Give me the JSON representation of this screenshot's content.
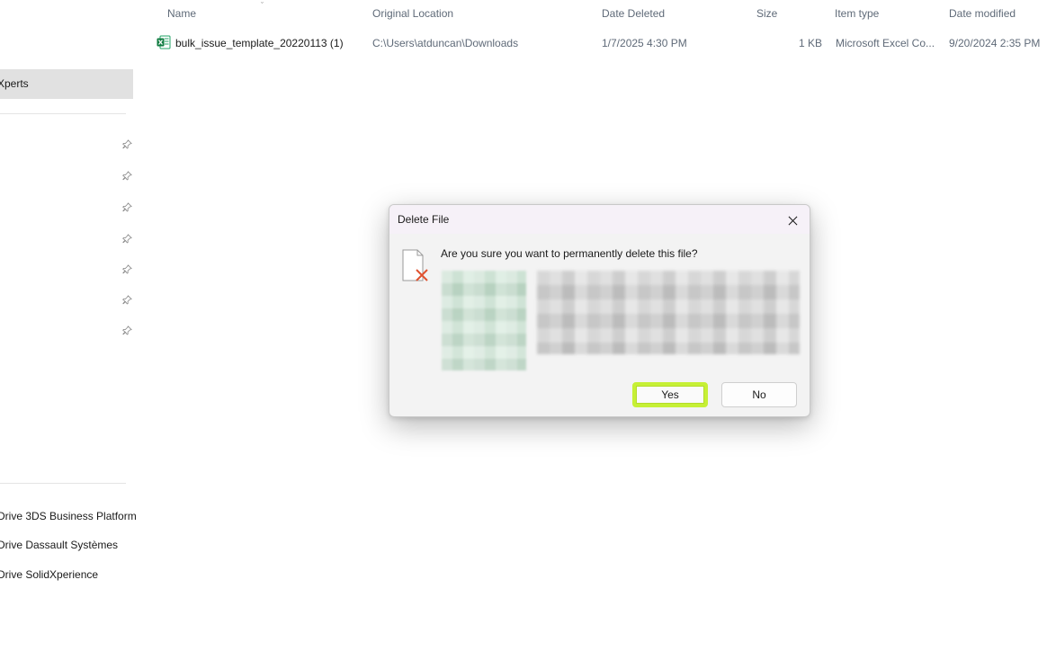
{
  "sidebar": {
    "selected_item": "Xperts",
    "pinned_count": 7,
    "links": [
      "Drive 3DS Business Platform",
      "Drive Dassault Systèmes",
      "Drive SolidXperience"
    ]
  },
  "file_list": {
    "columns": [
      "Name",
      "Original Location",
      "Date Deleted",
      "Size",
      "Item type",
      "Date modified"
    ],
    "rows": [
      {
        "name": "bulk_issue_template_20220113 (1)",
        "original_location": "C:\\Users\\atduncan\\Downloads",
        "date_deleted": "1/7/2025 4:30 PM",
        "size": "1 KB",
        "item_type": "Microsoft Excel Co...",
        "date_modified": "9/20/2024 2:35 PM",
        "icon": "excel-file-icon"
      }
    ]
  },
  "dialog": {
    "title": "Delete File",
    "message": "Are you sure you want to permanently delete this file?",
    "yes_label": "Yes",
    "no_label": "No",
    "icons": [
      "delete-file-icon",
      "close-icon"
    ],
    "highlight_color": "#c6f035"
  }
}
